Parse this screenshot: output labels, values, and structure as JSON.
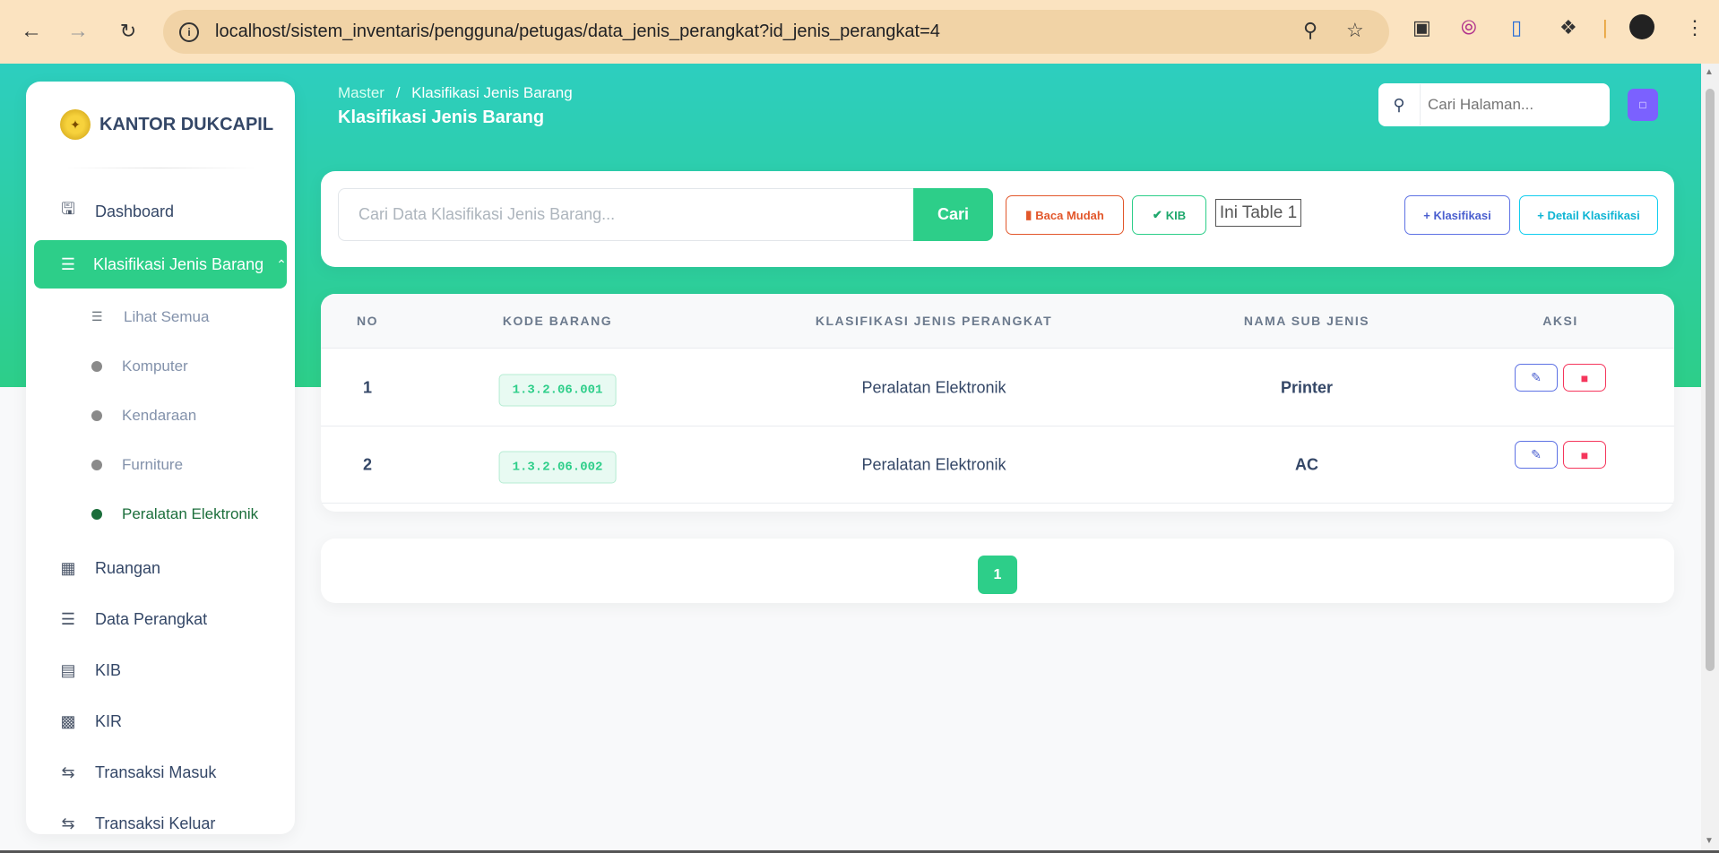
{
  "browser": {
    "url": "localhost/sistem_inventaris/pengguna/petugas/data_jenis_perangkat?id_jenis_perangkat=4"
  },
  "sidebar": {
    "brand": "KANTOR DUKCAPIL",
    "items": [
      {
        "label": "Dashboard",
        "icon": "monitor-icon"
      },
      {
        "label": "Klasifikasi Jenis Barang",
        "icon": "layers-icon",
        "active": true
      },
      {
        "label": "Ruangan",
        "icon": "building-icon"
      },
      {
        "label": "Data Perangkat",
        "icon": "layers-icon"
      },
      {
        "label": "KIB",
        "icon": "archive-icon"
      },
      {
        "label": "KIR",
        "icon": "briefcase-icon"
      },
      {
        "label": "Transaksi Masuk",
        "icon": "exchange-icon"
      },
      {
        "label": "Transaksi Keluar",
        "icon": "exchange-icon"
      }
    ],
    "sub_items": [
      {
        "label": "Lihat Semua"
      },
      {
        "label": "Komputer"
      },
      {
        "label": "Kendaraan"
      },
      {
        "label": "Furniture"
      },
      {
        "label": "Peralatan Elektronik",
        "current": true
      }
    ]
  },
  "header": {
    "breadcrumb_root": "Master",
    "breadcrumb_sep": "/",
    "breadcrumb_current": "Klasifikasi Jenis Barang",
    "title": "Klasifikasi Jenis Barang",
    "search_placeholder": "Cari Halaman..."
  },
  "toolbar": {
    "search_placeholder": "Cari Data Klasifikasi Jenis Barang...",
    "search_button": "Cari",
    "baca_mudah": "Baca Mudah",
    "kib": "KIB",
    "ini_table": "Ini Table 1",
    "add_klasifikasi": "+ Klasifikasi",
    "add_detail": "+ Detail Klasifikasi"
  },
  "table": {
    "headers": [
      "NO",
      "KODE BARANG",
      "KLASIFIKASI JENIS PERANGKAT",
      "NAMA SUB JENIS",
      "AKSI"
    ],
    "rows": [
      {
        "no": "1",
        "kode": "1.3.2.06.001",
        "klasifikasi": "Peralatan Elektronik",
        "nama": "Printer"
      },
      {
        "no": "2",
        "kode": "1.3.2.06.002",
        "klasifikasi": "Peralatan Elektronik",
        "nama": "AC"
      }
    ]
  },
  "pagination": {
    "current": "1"
  },
  "colors": {
    "primary_green": "#2dce89",
    "gradient_start": "#2dcebf",
    "chrome_bg": "#fbe3c0"
  }
}
